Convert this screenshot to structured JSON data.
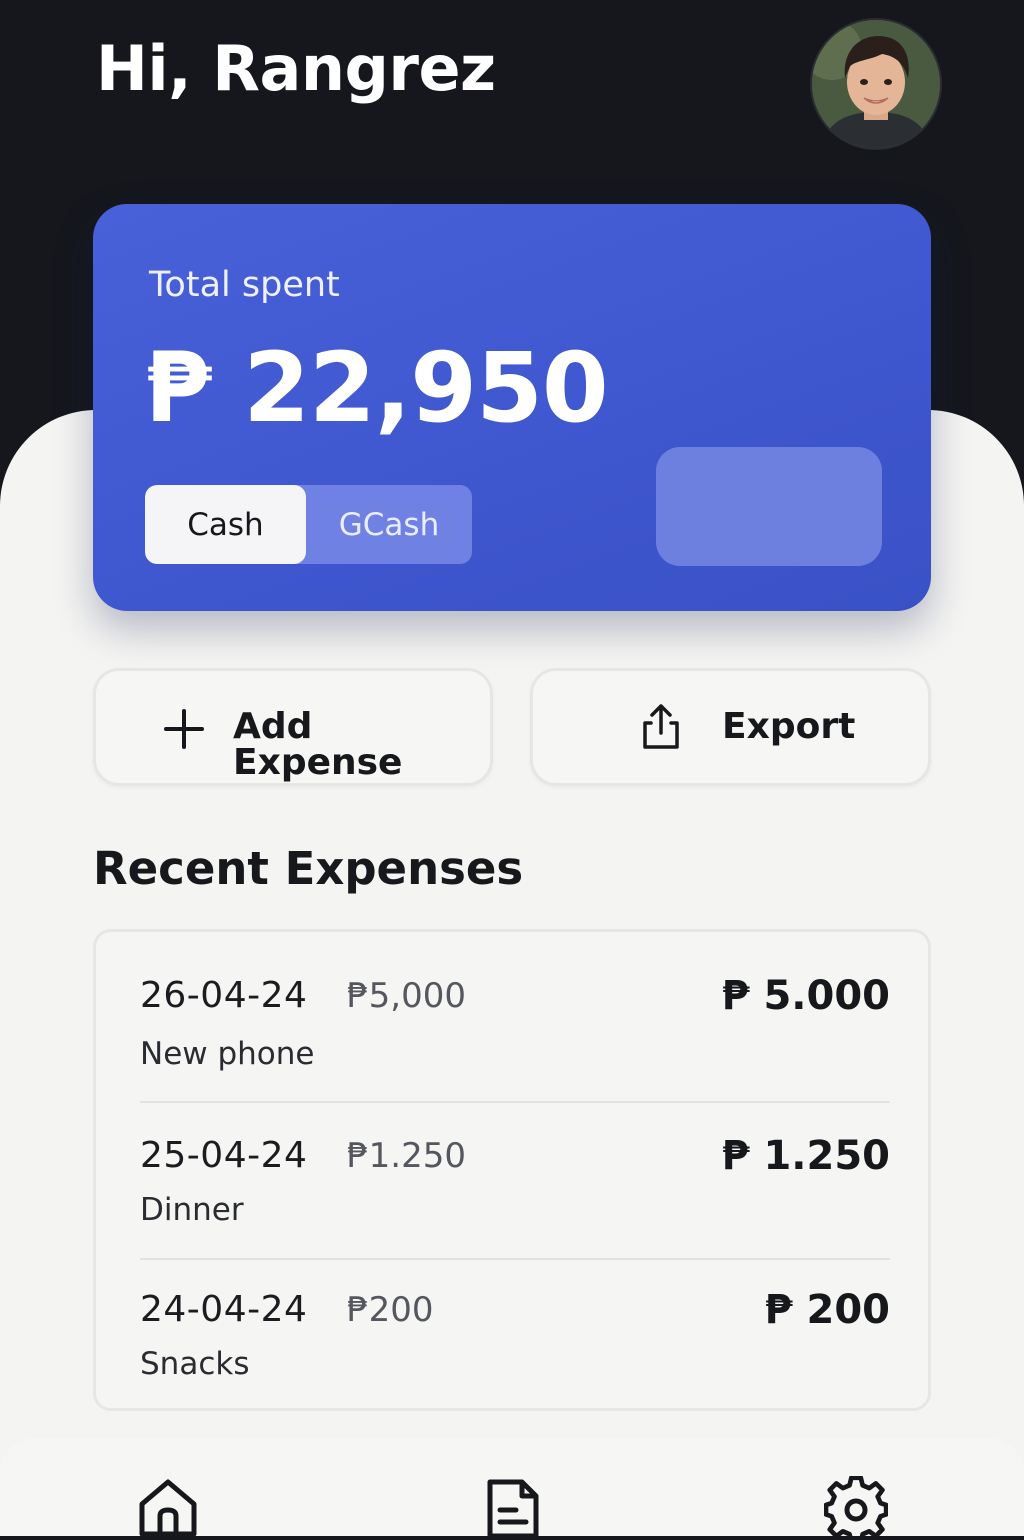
{
  "header": {
    "greeting": "Hi, Rangrez",
    "avatar_icon": "user-avatar-photo"
  },
  "summary": {
    "label": "Total spent",
    "amount": "₱ 22,950",
    "accent_color": "#4158d0",
    "payment_tabs": [
      {
        "label": "Cash",
        "selected": true
      },
      {
        "label": "GCash",
        "selected": false
      }
    ]
  },
  "actions": {
    "add_label": "Add Expense",
    "add_icon": "plus-icon",
    "export_label": "Export",
    "export_icon": "share-upload-icon"
  },
  "recent": {
    "title": "Recent Expenses",
    "items": [
      {
        "date": "26-04-24",
        "mid": "₱5,000",
        "desc": "New phone",
        "amount": "₱ 5.000"
      },
      {
        "date": "25-04-24",
        "mid": "₱1.250",
        "desc": "Dinner",
        "amount": "₱ 1.250"
      },
      {
        "date": "24-04-24",
        "mid": "₱200",
        "desc": "Snacks",
        "amount": "₱ 200"
      }
    ]
  },
  "nav": {
    "items": [
      {
        "icon": "home-icon"
      },
      {
        "icon": "document-icon"
      },
      {
        "icon": "gear-icon"
      }
    ]
  }
}
